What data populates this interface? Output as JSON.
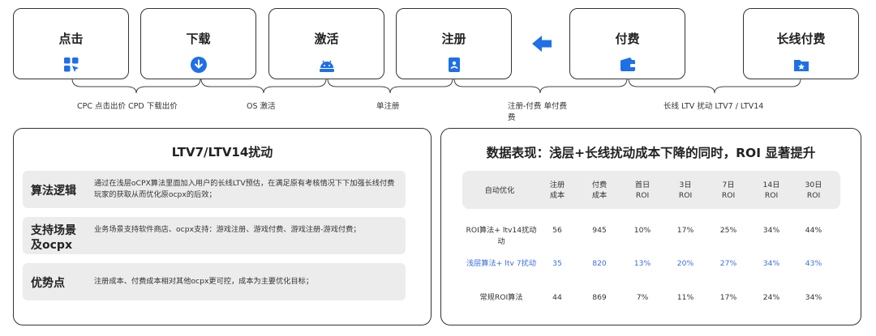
{
  "stages": [
    {
      "label": "点击",
      "icon": "grid-click-icon"
    },
    {
      "label": "下载",
      "icon": "download-icon"
    },
    {
      "label": "激活",
      "icon": "android-icon"
    },
    {
      "label": "注册",
      "icon": "register-card-icon"
    },
    {
      "label": "付费",
      "icon": "wallet-icon"
    },
    {
      "label": "长线付费",
      "icon": "star-folder-icon"
    }
  ],
  "arrow_icon": "left-arrow-icon",
  "captions": {
    "c1": "CPC 点击出价 CPD 下载出价",
    "c2": "OS 激活",
    "c3": "单注册",
    "c4a": "注册-付费  单付费",
    "c4b": "费",
    "c5": "长线 LTV 扰动  LTV7 / LTV14"
  },
  "left_panel": {
    "title": "LTV7/LTV14扰动",
    "rows": [
      {
        "head": "算法逻辑",
        "body": "通过在浅层oCPX算法里面加入用户的长线LTV预估，在满足原有考核情况下下加强长线付费玩家的获取从而优化原ocpx的后效；"
      },
      {
        "head_l1": "支持场景",
        "head_l2": "及ocpx",
        "body": "业务场景支持软件商店、ocpx支持：游戏注册、游戏付费、游戏注册-游戏付费；"
      },
      {
        "head": "优势点",
        "body": "注册成本、付费成本相对其他ocpx更可控，成本为主要优化目标；"
      }
    ]
  },
  "right_panel": {
    "title": "数据表现：浅层+长线扰动成本下降的同时，ROI 显著提升",
    "headers": [
      [
        "自动优化"
      ],
      [
        "注册",
        "成本"
      ],
      [
        "付费",
        "成本"
      ],
      [
        "首日",
        "ROI"
      ],
      [
        "3日",
        "ROI"
      ],
      [
        "7日",
        "ROI"
      ],
      [
        "14日",
        "ROI"
      ],
      [
        "30日",
        "ROI"
      ]
    ],
    "rows": [
      {
        "name_l1": "ROI算法+ ltv14扰动",
        "name_l2": "动",
        "values": [
          "56",
          "945",
          "10%",
          "17%",
          "25%",
          "34%",
          "44%"
        ],
        "highlight": false
      },
      {
        "name_l1": "浅层算法+ ltv 7扰动",
        "name_l2": "",
        "values": [
          "35",
          "820",
          "13%",
          "20%",
          "27%",
          "34%",
          "43%"
        ],
        "highlight": true
      },
      {
        "name_l1": "常规ROI算法",
        "name_l2": "",
        "values": [
          "44",
          "869",
          "7%",
          "11%",
          "17%",
          "24%",
          "34%"
        ],
        "highlight": false
      }
    ]
  },
  "colors": {
    "accent": "#1e6fe8",
    "highlight_text": "#3a6fe0",
    "row_bg": "#ececec"
  }
}
